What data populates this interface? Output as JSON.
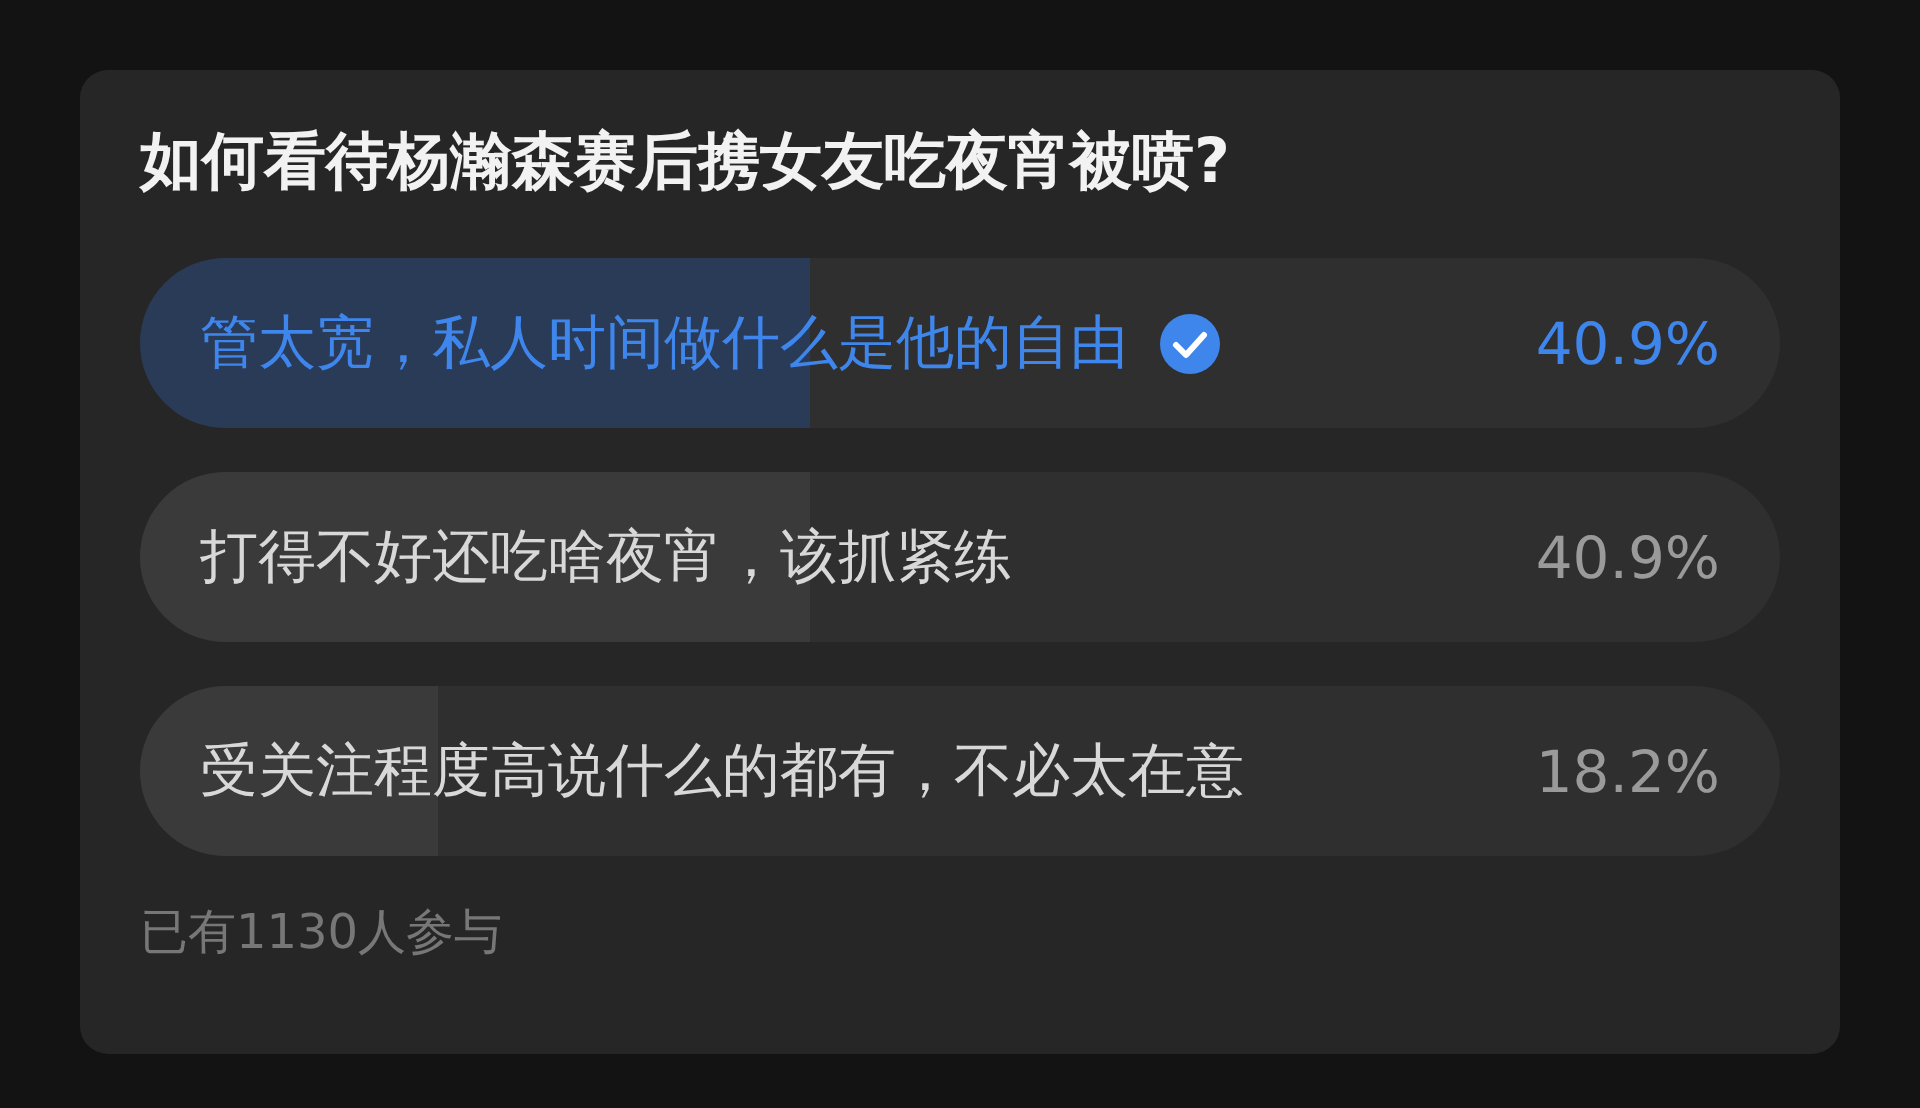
{
  "poll": {
    "question": "如何看待杨瀚森赛后携女友吃夜宵被喷?",
    "options": [
      {
        "label": "管太宽，私人时间做什么是他的自由",
        "percent": "40.9%",
        "level": 0.409,
        "selected": true
      },
      {
        "label": "打得不好还吃啥夜宵，该抓紧练",
        "percent": "40.9%",
        "level": 0.409,
        "selected": false
      },
      {
        "label": "受关注程度高说什么的都有，不必太在意",
        "percent": "18.2%",
        "level": 0.182,
        "selected": false
      }
    ],
    "participants": "已有1130人参与"
  }
}
